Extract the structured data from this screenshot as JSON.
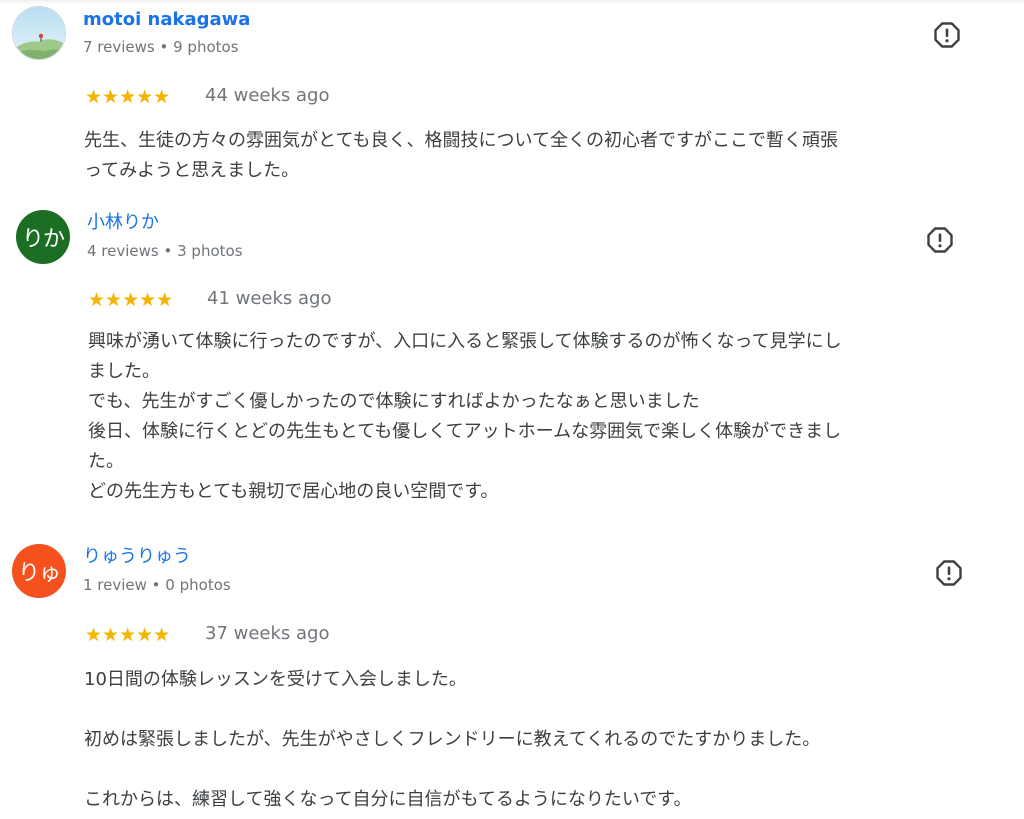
{
  "reviews": [
    {
      "author": "motoi nakagawa",
      "stats": "7 reviews • 9 photos",
      "avatar_type": "photo",
      "avatar_icon": "landscape-photo-icon",
      "rating": 5,
      "stars": "★★★★★",
      "age": "44 weeks ago",
      "report_icon": "report-icon",
      "lines": [
        "先生、生徒の方々の雰囲気がとても良く、格闘技について全くの初心者ですがここで暫く頑張",
        "ってみようと思えました。"
      ]
    },
    {
      "author": "小林りか",
      "stats": "4 reviews • 3 photos",
      "avatar_type": "initials",
      "avatar_text": "りか",
      "avatar_color": "#1b6e24",
      "rating": 5,
      "stars": "★★★★★",
      "age": "41 weeks ago",
      "report_icon": "report-icon",
      "lines": [
        "興味が湧いて体験に行ったのですが、入口に入ると緊張して体験するのが怖くなって見学にし",
        "ました。",
        "でも、先生がすごく優しかったので体験にすればよかったなぁと思いました",
        "後日、体験に行くとどの先生もとても優しくてアットホームな雰囲気で楽しく体験ができまし",
        "た。",
        "どの先生方もとても親切で居心地の良い空間です。"
      ]
    },
    {
      "author": "りゅうりゅう",
      "stats": "1 review • 0 photos",
      "avatar_type": "initials",
      "avatar_text": "りゅ",
      "avatar_color": "#f4511e",
      "rating": 5,
      "stars": "★★★★★",
      "age": "37 weeks ago",
      "report_icon": "report-icon",
      "lines": [
        "10日間の体験レッスンを受けて入会しました。",
        "",
        "初めは緊張しましたが、先生がやさしくフレンドリーに教えてくれるのでたすかりました。",
        "",
        "これからは、練習して強くなって自分に自信がもてるようになりたいです。"
      ]
    }
  ]
}
